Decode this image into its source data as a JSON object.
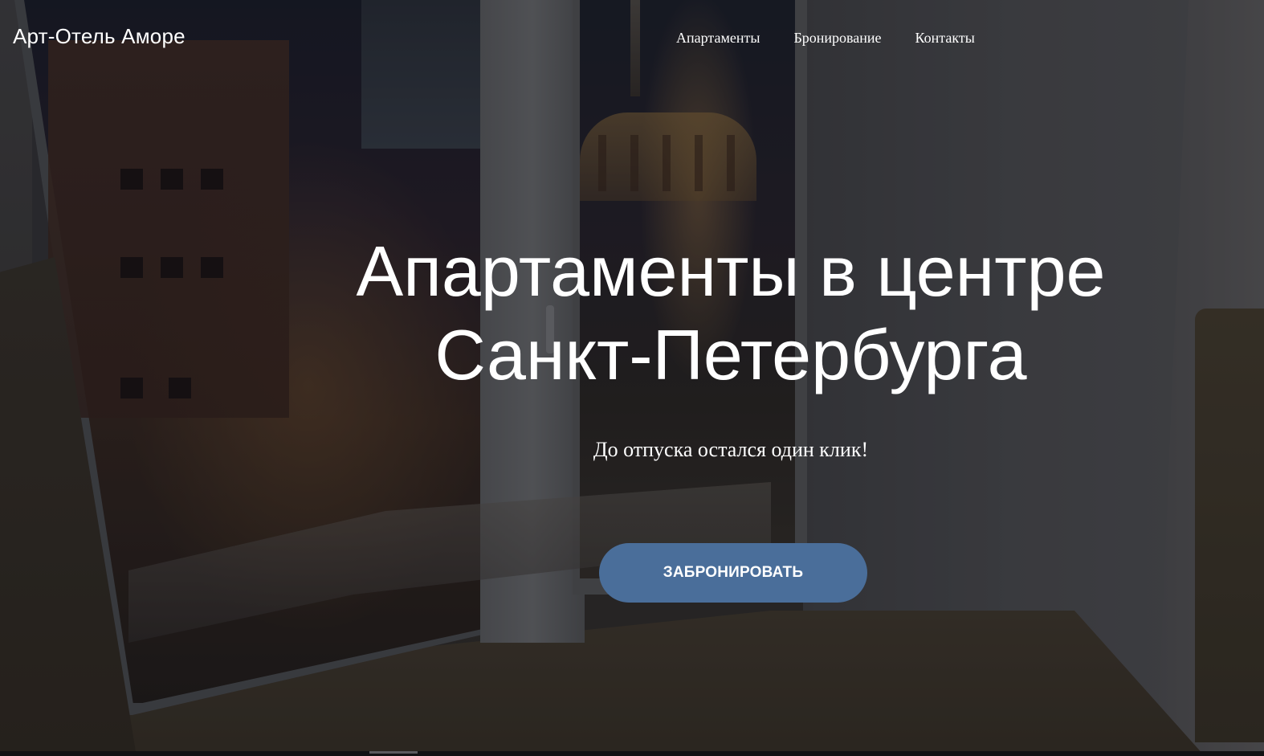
{
  "header": {
    "logo": "Арт-Отель Аморе",
    "nav": [
      {
        "label": "Апартаменты"
      },
      {
        "label": "Бронирование"
      },
      {
        "label": "Контакты"
      }
    ]
  },
  "hero": {
    "title_line1": "Апартаменты в центре",
    "title_line2": "Санкт-Петербурга",
    "subtitle": "До отпуска остался один клик!",
    "cta_label": "ЗАБРОНИРОВАТЬ"
  },
  "colors": {
    "cta_background": "#4a6e9a",
    "text": "#ffffff"
  }
}
